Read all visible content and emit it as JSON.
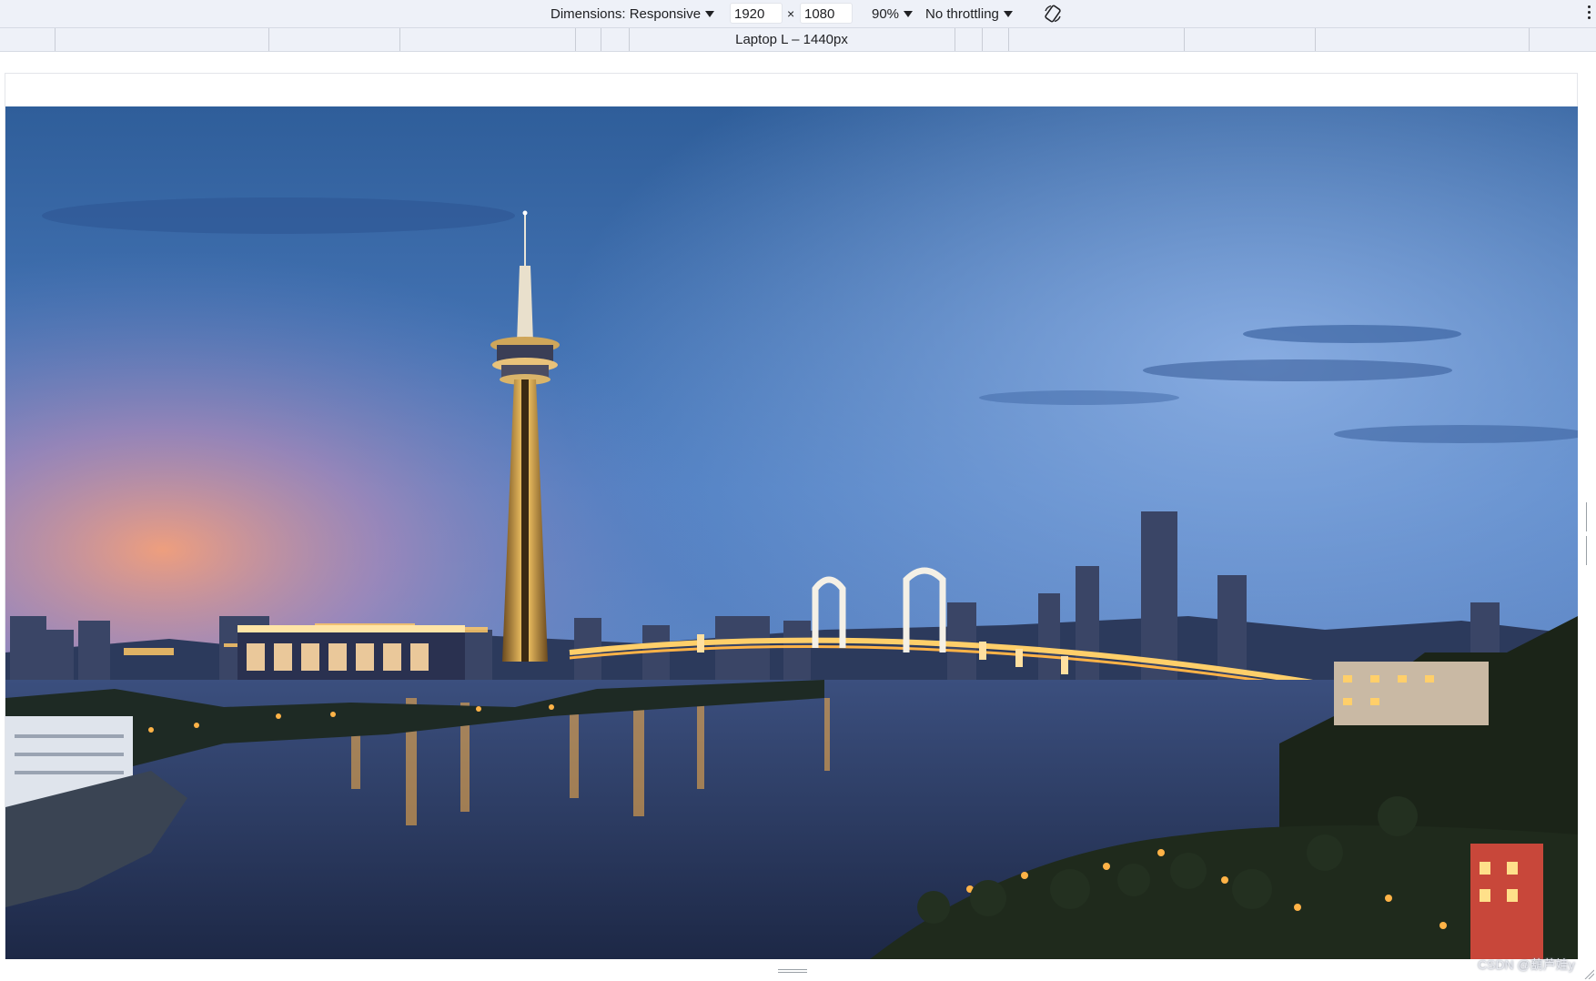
{
  "toolbar": {
    "dimensions_label": "Dimensions: Responsive",
    "width_value": "1920",
    "times_symbol": "×",
    "height_value": "1080",
    "zoom_label": "90%",
    "throttling_label": "No throttling",
    "rotate_icon": "rotate-device-icon",
    "more_icon": "more-vertical-icon"
  },
  "media_query_bar": {
    "label": "Laptop L – 1440px"
  },
  "viewport": {
    "hero_image_subject": "Macau night skyline with Macau Tower, Sai Van Bridge and illuminated waterfront under blue evening sky"
  },
  "watermark": {
    "text": "CSDN @葫芦娃y"
  },
  "colors": {
    "toolbar_bg": "#eef1f8",
    "sky_top": "#2f5e9a",
    "sky_bottom": "#6f98d6",
    "city_lights": "#ffb347"
  }
}
